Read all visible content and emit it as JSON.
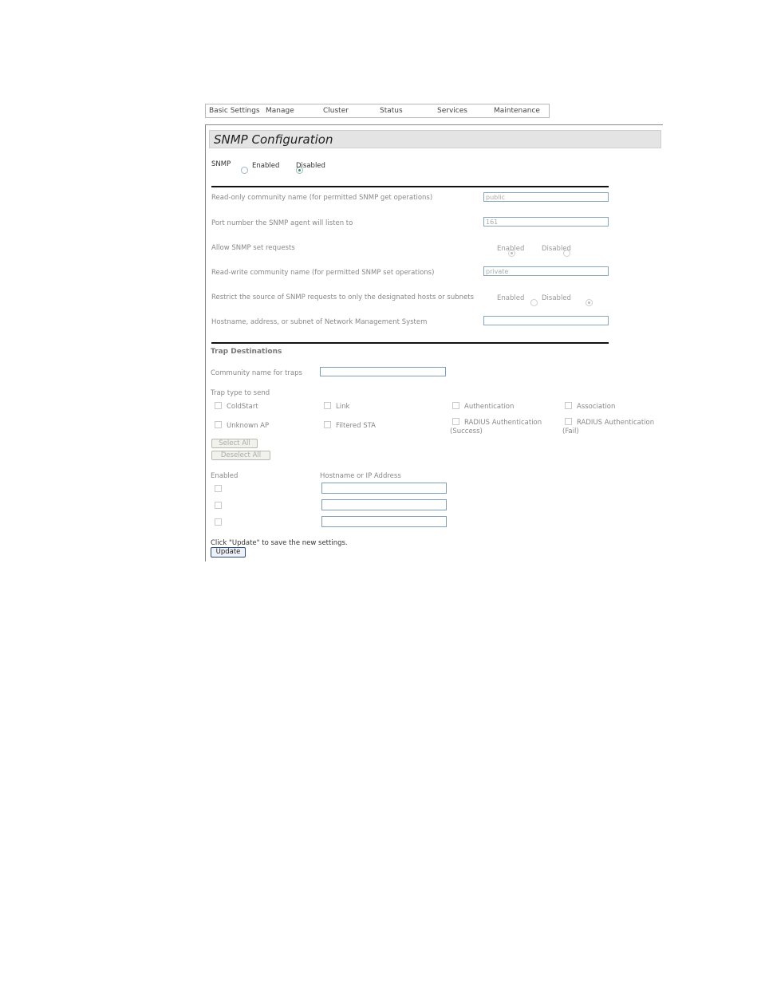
{
  "nav": {
    "items": [
      "Basic Settings",
      "Manage",
      "Cluster",
      "Status",
      "Services",
      "Maintenance"
    ]
  },
  "page": {
    "title": "SNMP Configuration"
  },
  "snmp": {
    "label": "SNMP",
    "options": [
      "Enabled",
      "Disabled"
    ],
    "selected": "Disabled"
  },
  "settings": {
    "read_only_label": "Read-only community name (for permitted SNMP get operations)",
    "read_only_value": "public",
    "port_label": "Port number the SNMP agent will listen to",
    "port_value": "161",
    "allow_set_label": "Allow SNMP set requests",
    "allow_set_options": [
      "Enabled",
      "Disabled"
    ],
    "allow_set_selected": "Enabled",
    "read_write_label": "Read-write community name (for permitted SNMP set operations)",
    "read_write_value": "private",
    "restrict_label": "Restrict the source of SNMP requests to only the designated hosts or subnets",
    "restrict_options": [
      "Enabled",
      "Disabled"
    ],
    "restrict_selected": "Disabled",
    "nms_label": "Hostname, address, or subnet of Network Management System",
    "nms_value": ""
  },
  "traps": {
    "heading": "Trap Destinations",
    "community_label": "Community name for traps",
    "community_value": "",
    "type_label": "Trap type to send",
    "types": [
      {
        "label": "ColdStart",
        "checked": false
      },
      {
        "label": "Link",
        "checked": false
      },
      {
        "label": "Authentication",
        "checked": false
      },
      {
        "label": "Association",
        "checked": false
      },
      {
        "label": "Unknown AP",
        "checked": false
      },
      {
        "label": "Filtered STA",
        "checked": false
      },
      {
        "label": "RADIUS Authentication",
        "sub": "(Success)",
        "checked": false
      },
      {
        "label": "RADIUS Authentication",
        "sub": "(Fail)",
        "checked": false
      }
    ],
    "select_all": "Select All",
    "deselect_all": "Deselect All",
    "enabled_header": "Enabled",
    "host_header": "Hostname or IP Address",
    "hosts": [
      {
        "enabled": false,
        "value": ""
      },
      {
        "enabled": false,
        "value": ""
      },
      {
        "enabled": false,
        "value": ""
      }
    ]
  },
  "footer": {
    "hint": "Click \"Update\" to save the new settings.",
    "update_label": "Update"
  }
}
